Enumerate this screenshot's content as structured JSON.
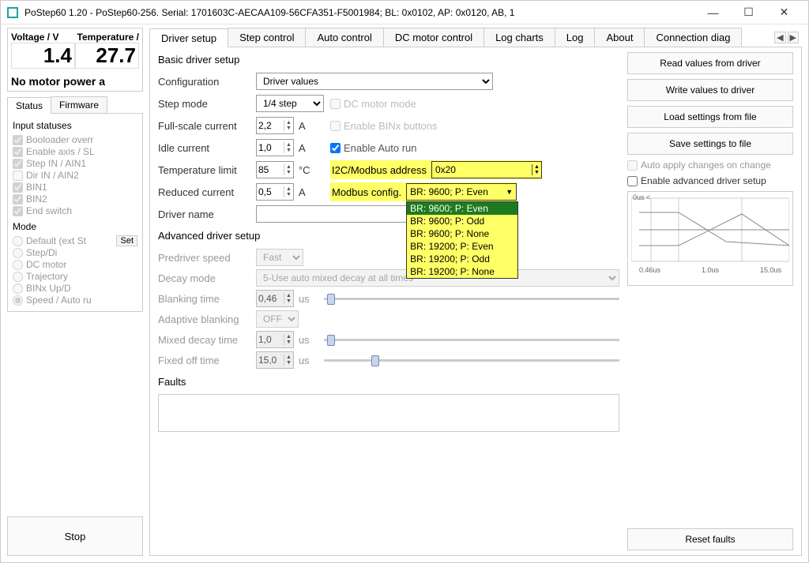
{
  "window": {
    "title": "PoStep60 1.20 - PoStep60-256. Serial: 1701603C-AECAA109-56CFA351-F5001984; BL: 0x0102, AP: 0x0120, AB, 1"
  },
  "gauges": {
    "voltage_label": "Voltage / V",
    "temperature_label": "Temperature /",
    "voltage_value": "1.4",
    "temperature_value": "27.7",
    "no_motor": "No motor power a"
  },
  "left_tabs": {
    "status": "Status",
    "firmware": "Firmware"
  },
  "input_statuses": {
    "title": "Input statuses",
    "items": [
      "Booloader overr",
      "Enable axis / SL",
      "Step IN / AIN1",
      "Dir IN / AIN2",
      "BIN1",
      "BIN2",
      "End switch"
    ]
  },
  "mode": {
    "title": "Mode",
    "items": [
      "Default (ext St",
      "Step/Di",
      "DC motor",
      "Trajectory",
      "BINx Up/D",
      "Speed / Auto ru"
    ],
    "set_btn": "Set"
  },
  "stop_btn": "Stop",
  "tabs": [
    "Driver setup",
    "Step control",
    "Auto control",
    "DC motor control",
    "Log charts",
    "Log",
    "About",
    "Connection diag"
  ],
  "basic": {
    "title": "Basic driver setup",
    "configuration_label": "Configuration",
    "configuration_value": "Driver values",
    "step_mode_label": "Step mode",
    "step_mode_value": "1/4 step",
    "dc_motor_mode": "DC motor mode",
    "full_scale_label": "Full-scale current",
    "full_scale_value": "2,2",
    "enable_binx": "Enable BINx buttons",
    "idle_label": "Idle current",
    "idle_value": "1,0",
    "enable_auto": "Enable Auto run",
    "temp_label": "Temperature limit",
    "temp_value": "85",
    "temp_unit": "°C",
    "i2c_label": "I2C/Modbus address",
    "i2c_value": "0x20",
    "reduced_label": "Reduced current",
    "reduced_value": "0,5",
    "modbus_label": "Modbus config.",
    "modbus_value": "BR: 9600; P: Even",
    "modbus_options": [
      "BR: 9600; P: Even",
      "BR: 9600; P: Odd",
      "BR: 9600; P: None",
      "BR: 19200; P: Even",
      "BR: 19200; P: Odd",
      "BR: 19200; P: None"
    ],
    "driver_name_label": "Driver name",
    "unit_a": "A"
  },
  "advanced": {
    "title": "Advanced driver setup",
    "predriver_label": "Predriver speed",
    "predriver_value": "Fast",
    "decay_label": "Decay mode",
    "decay_value": "5-Use auto mixed decay at all times",
    "blanking_label": "Blanking time",
    "blanking_value": "0,46",
    "adaptive_label": "Adaptive blanking",
    "adaptive_value": "OFF",
    "mixed_label": "Mixed decay time",
    "mixed_value": "1,0",
    "fixed_label": "Fixed off time",
    "fixed_value": "15,0",
    "unit_us": "us"
  },
  "faults": {
    "title": "Faults",
    "reset": "Reset faults"
  },
  "side": {
    "read": "Read values from driver",
    "write": "Write values to driver",
    "load": "Load settings from file",
    "save": "Save settings to file",
    "auto_apply": "Auto apply changes on change",
    "enable_adv": "Enable advanced driver setup"
  },
  "chart": {
    "toplabel": "0us <",
    "x": [
      "0.46us",
      "1.0us",
      "15.0us"
    ]
  }
}
